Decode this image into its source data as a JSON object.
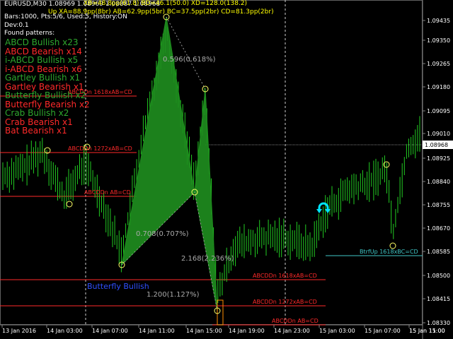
{
  "header": {
    "symbol": "EURUSD,M30",
    "ohlc": "1.08969 1.08969 1.08887 1.08968",
    "harmonic_line1": "XB=48.8pp(61.8) BD=46.1(50.0) XD=128.0(138.2)",
    "harmonic_line2": "Up XA=88.9pp(8br) AB=62.9pp(5br) BC=37.5pp(2br) CD=81.3pp(2br)"
  },
  "info": {
    "bars": "Bars:1000, Pts:5/6, Used:5, History:ON",
    "dev": "Dev:0.1",
    "found": "Found patterns:"
  },
  "patterns": [
    {
      "label": "ABCD Bullish x23",
      "color": "#2ea82e"
    },
    {
      "label": "ABCD Bearish x14",
      "color": "#ff2a2a"
    },
    {
      "label": "i-ABCD Bullish x5",
      "color": "#2ea82e"
    },
    {
      "label": "i-ABCD Bearish x6",
      "color": "#ff2a2a"
    },
    {
      "label": "Gartley Bullish x1",
      "color": "#2ea82e"
    },
    {
      "label": "Gartley Bearish x1",
      "color": "#ff2a2a"
    },
    {
      "label": "Butterfly Bullish x2",
      "color": "#2ea82e"
    },
    {
      "label": "Butterfly Bearish x2",
      "color": "#ff2a2a"
    },
    {
      "label": "Crab Bullish x2",
      "color": "#2ea82e"
    },
    {
      "label": "Crab Bearish x1",
      "color": "#ff2a2a"
    },
    {
      "label": "Bat Bearish x1",
      "color": "#ff2a2a"
    }
  ],
  "price_axis": {
    "ticks": [
      "1.09435",
      "1.09350",
      "1.09265",
      "1.09180",
      "1.09095",
      "1.09010",
      "1.08925",
      "1.08840",
      "1.08755",
      "1.08670",
      "1.08585",
      "1.08500",
      "1.08415",
      "1.08330"
    ],
    "current": "1.08968"
  },
  "time_axis": {
    "ticks": [
      "13 Jan 2016",
      "14 Jan 03:00",
      "14 Jan 07:00",
      "14 Jan 11:00",
      "14 Jan 15:00",
      "14 Jan 19:00",
      "14 Jan 23:00",
      "15 Jan 03:00",
      "15 Jan 07:00",
      "15 Jan 11:00",
      "15 Jan 15:00"
    ]
  },
  "level_labels": [
    "ABCDDn 1618xAB=CD",
    "ABCDDn 1272xAB=CD",
    "ABCDDn AB=CD",
    "ABCDDn 1618xAB=CD",
    "ABCDDn 1272xAB=CD",
    "ABCDDn AB=CD",
    "BtrfUp 1618xBC=CD"
  ],
  "ratios": {
    "r1": "0.596(0.618%)",
    "r2": "0.708(0.707%)",
    "r3": "2.168(2.236%)",
    "r4": "1.200(1.127%)"
  },
  "pattern_name": "Butterfly Bullish",
  "colors": {
    "background": "#000000",
    "bullish": "#2ea82e",
    "bearish": "#ff2a2a",
    "pattern_fill": "#1e8c1e",
    "candle": "#22cc22",
    "pivot": "#ffff66",
    "level_line": "#ff2a2a",
    "target_line": "#40c8c8",
    "arrow": "#00e5ff"
  }
}
